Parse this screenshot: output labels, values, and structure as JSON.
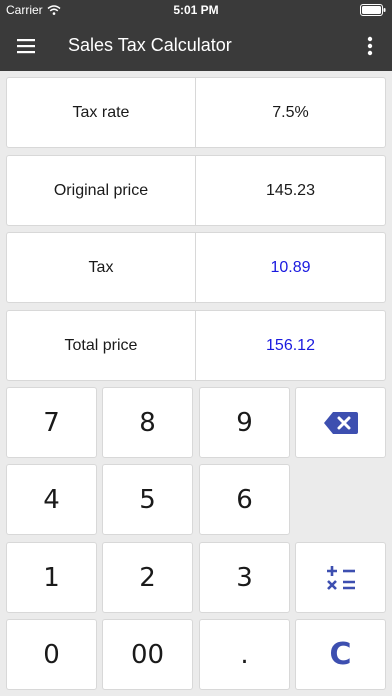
{
  "status_bar": {
    "carrier": "Carrier",
    "time": "5:01 PM"
  },
  "app_bar": {
    "title": "Sales Tax Calculator"
  },
  "fields": {
    "tax_rate": {
      "label": "Tax rate",
      "value": "7.5%"
    },
    "original_price": {
      "label": "Original price",
      "value": "145.23"
    },
    "tax": {
      "label": "Tax",
      "value": "10.89"
    },
    "total_price": {
      "label": "Total price",
      "value": "156.12"
    }
  },
  "keypad": {
    "k7": "7",
    "k8": "8",
    "k9": "9",
    "k4": "4",
    "k5": "5",
    "k6": "6",
    "k1": "1",
    "k2": "2",
    "k3": "3",
    "k0": "0",
    "k00": "00",
    "kdot": ".",
    "clear": "C"
  },
  "colors": {
    "app_bar": "#3a3a3a",
    "result_text": "#1a1adf",
    "function_key": "#3d4fb0"
  },
  "icons": {
    "menu": "hamburger-icon",
    "overflow": "more-vert-icon",
    "backspace": "backspace-icon",
    "operations": "plus-minus-times-equals-icon"
  }
}
